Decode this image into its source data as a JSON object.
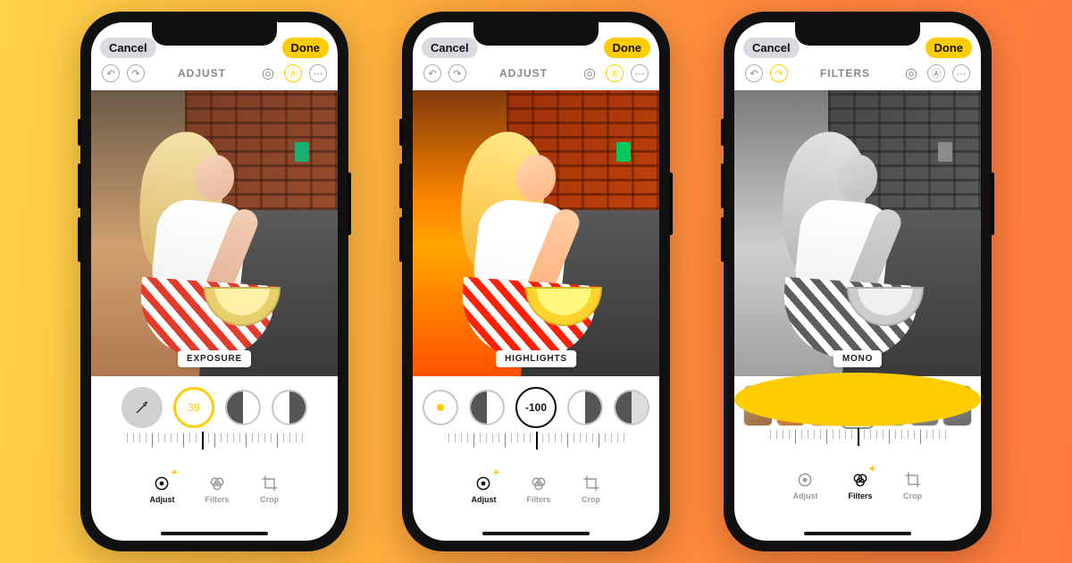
{
  "common": {
    "cancel": "Cancel",
    "done": "Done",
    "modes": {
      "adjust": "Adjust",
      "filters": "Filters",
      "crop": "Crop"
    }
  },
  "phones": [
    {
      "tab": "ADJUST",
      "chip": "EXPOSURE",
      "dial_value": "39",
      "active_mode": "adjust",
      "photo_variant": "color"
    },
    {
      "tab": "ADJUST",
      "chip": "HIGHLIGHTS",
      "dial_value": "-100",
      "active_mode": "adjust",
      "photo_variant": "sat"
    },
    {
      "tab": "FILTERS",
      "chip": "MONO",
      "active_mode": "filters",
      "photo_variant": "mono"
    }
  ]
}
